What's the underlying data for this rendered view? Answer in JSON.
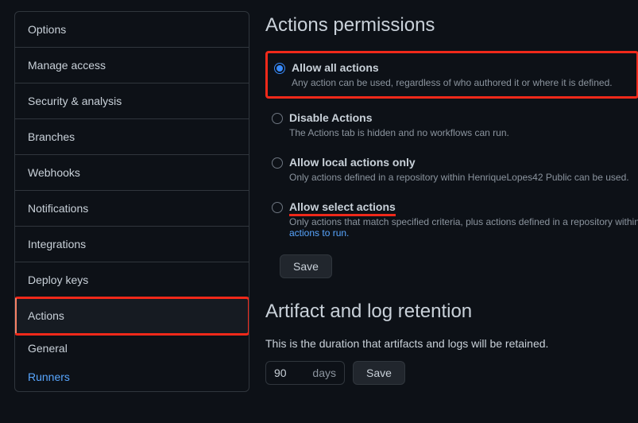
{
  "sidebar": {
    "items": [
      {
        "label": "Options"
      },
      {
        "label": "Manage access"
      },
      {
        "label": "Security & analysis"
      },
      {
        "label": "Branches"
      },
      {
        "label": "Webhooks"
      },
      {
        "label": "Notifications"
      },
      {
        "label": "Integrations"
      },
      {
        "label": "Deploy keys"
      },
      {
        "label": "Actions"
      }
    ],
    "sub": [
      {
        "label": "General"
      },
      {
        "label": "Runners"
      }
    ]
  },
  "permissions": {
    "title": "Actions permissions",
    "options": [
      {
        "label": "Allow all actions",
        "desc": "Any action can be used, regardless of who authored it or where it is defined."
      },
      {
        "label": "Disable Actions",
        "desc": "The Actions tab is hidden and no workflows can run."
      },
      {
        "label": "Allow local actions only",
        "desc": "Only actions defined in a repository within HenriqueLopes42 Public can be used."
      },
      {
        "label": "Allow select actions",
        "desc_prefix": "Only actions that match specified criteria, plus actions defined in a repository within H",
        "desc_link": "actions to run."
      }
    ],
    "save": "Save"
  },
  "artifact": {
    "title": "Artifact and log retention",
    "desc": "This is the duration that artifacts and logs will be retained.",
    "value": "90",
    "suffix": "days",
    "save": "Save"
  }
}
